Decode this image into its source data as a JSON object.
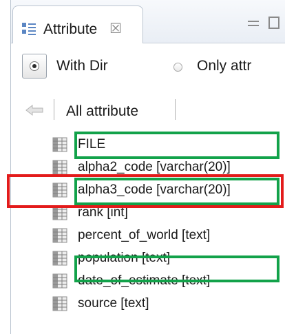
{
  "tab": {
    "title": "Attribute",
    "close_glyph": "☒"
  },
  "options": {
    "with_dir_label": "With Dir",
    "only_attr_label": "Only attr",
    "selected": "With Dir"
  },
  "toolbar": {
    "label": "All attribute"
  },
  "attributes": [
    {
      "label": "FILE"
    },
    {
      "label": "alpha2_code [varchar(20)]"
    },
    {
      "label": "alpha3_code [varchar(20)]"
    },
    {
      "label": "rank [int]"
    },
    {
      "label": "percent_of_world [text]"
    },
    {
      "label": "population [text]"
    },
    {
      "label": "date_of_estimate [text]"
    },
    {
      "label": "source [text]"
    }
  ],
  "highlights": [
    {
      "row": "FILE",
      "color": "#12a24a"
    },
    {
      "row": "alpha3_code [varchar(20)]",
      "color": "#e31b1b"
    },
    {
      "row": "population [text]",
      "color": "#12a24a"
    }
  ],
  "icons": [
    "attribute-view-icon",
    "close-icon",
    "minimize-icon",
    "maximize-icon",
    "back-arrow-icon",
    "column-icon"
  ]
}
